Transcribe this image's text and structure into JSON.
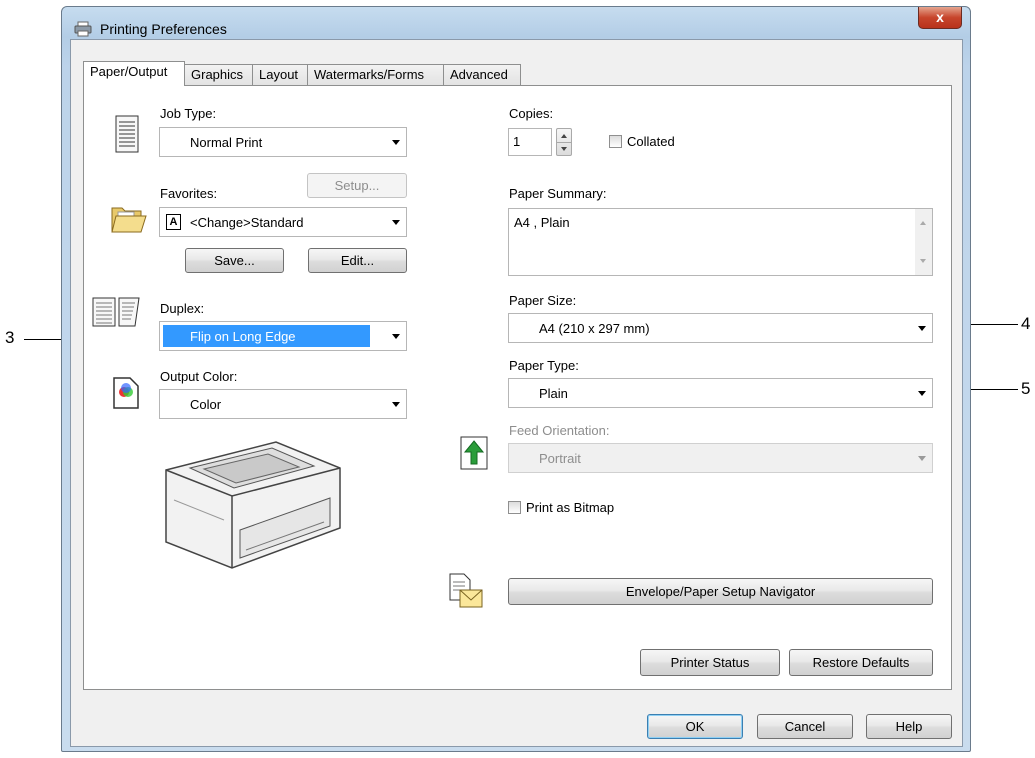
{
  "window": {
    "title": "Printing Preferences",
    "close_label": "x"
  },
  "tabs": [
    "Paper/Output",
    "Graphics",
    "Layout",
    "Watermarks/Forms",
    "Advanced"
  ],
  "left": {
    "job_type_label": "Job Type:",
    "job_type_value": "Normal Print",
    "favorites_label": "Favorites:",
    "setup_label": "Setup...",
    "favorites_prefix": "A",
    "favorites_value": "<Change>Standard",
    "save_label": "Save...",
    "edit_label": "Edit...",
    "duplex_label": "Duplex:",
    "duplex_value": "Flip on Long Edge",
    "output_color_label": "Output Color:",
    "output_color_value": "Color"
  },
  "right": {
    "copies_label": "Copies:",
    "copies_value": "1",
    "collated_label": "Collated",
    "paper_summary_label": "Paper Summary:",
    "paper_summary_value": "A4 , Plain",
    "paper_size_label": "Paper Size:",
    "paper_size_value": "A4 (210 x 297 mm)",
    "paper_type_label": "Paper Type:",
    "paper_type_value": "Plain",
    "feed_orientation_label": "Feed Orientation:",
    "feed_orientation_value": "Portrait",
    "print_as_bitmap_label": "Print as Bitmap",
    "envelope_nav_label": "Envelope/Paper Setup Navigator",
    "printer_status_label": "Printer Status",
    "restore_defaults_label": "Restore Defaults"
  },
  "footer": {
    "ok_label": "OK",
    "cancel_label": "Cancel",
    "help_label": "Help"
  },
  "callouts": {
    "c3": "3",
    "c4": "4",
    "c5": "5"
  },
  "colors": {
    "selection": "#3399ff",
    "window_frame": "#b9d1ea",
    "close_button": "#c7452c"
  }
}
